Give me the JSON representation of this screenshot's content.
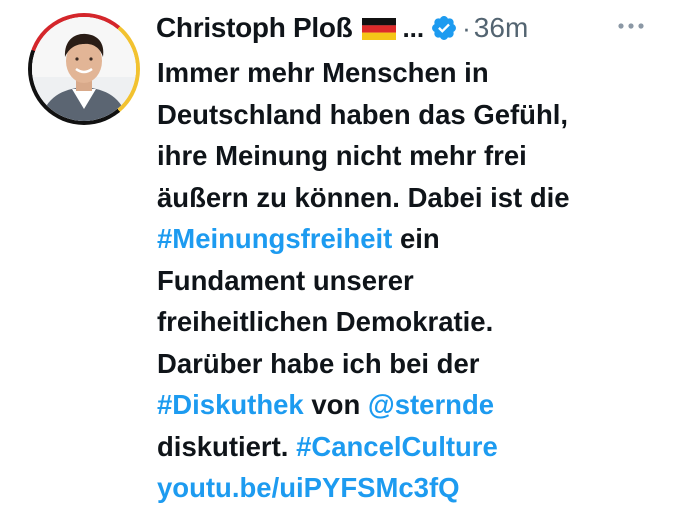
{
  "tweet": {
    "author_name": "Christoph Ploß",
    "flag_icon": "germany-flag-icon",
    "truncation": "...",
    "verified_icon": "verified-badge-icon",
    "separator": "·",
    "timestamp": "36m",
    "more_icon": "more-options-icon",
    "lines": [
      [
        {
          "t": "Immer mehr Menschen in",
          "link": false
        }
      ],
      [
        {
          "t": "Deutschland haben das Gefühl,",
          "link": false
        }
      ],
      [
        {
          "t": "ihre Meinung nicht mehr frei",
          "link": false
        }
      ],
      [
        {
          "t": "äußern zu können. Dabei ist die",
          "link": false
        }
      ],
      [
        {
          "t": "#Meinungsfreiheit",
          "link": true
        },
        {
          "t": " ein",
          "link": false
        }
      ],
      [
        {
          "t": "Fundament unserer",
          "link": false
        }
      ],
      [
        {
          "t": "freiheitlichen Demokratie.",
          "link": false
        }
      ],
      [
        {
          "t": "Darüber habe ich bei der",
          "link": false
        }
      ],
      [
        {
          "t": "#Diskuthek",
          "link": true
        },
        {
          "t": " von ",
          "link": false
        },
        {
          "t": "@sternde",
          "link": true
        }
      ],
      [
        {
          "t": "diskutiert. ",
          "link": false
        },
        {
          "t": "#CancelCulture",
          "link": true
        }
      ],
      [
        {
          "t": "youtu.be/uiPYFSMc3fQ",
          "link": true
        }
      ]
    ]
  },
  "colors": {
    "text": "#0f1419",
    "link": "#1d9bf0",
    "muted": "#536471",
    "verified": "#1d9bf0"
  }
}
